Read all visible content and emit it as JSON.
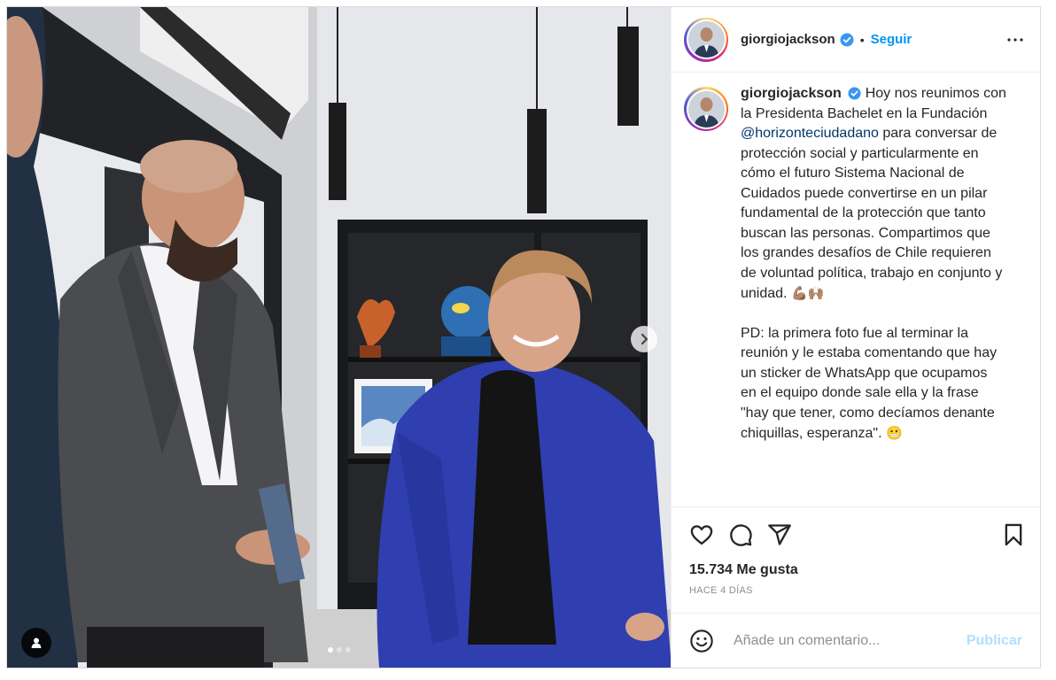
{
  "post": {
    "username": "giorgiojackson",
    "follow_label": "Seguir",
    "separator": "•",
    "caption": {
      "part1": "Hoy nos reunimos con la Presidenta Bachelet en la Fundación ",
      "mention": "@horizonteciudadano",
      "part2": " para conversar de protección social y particularmente en cómo el futuro Sistema Nacional de Cuidados puede convertirse en un pilar fundamental de la protección que tanto buscan las personas. Compartimos que los grandes desafíos de Chile requieren de voluntad política, trabajo en conjunto y unidad. ",
      "emoji1": "💪🏽🙌🏽",
      "part3": "PD: la primera foto fue al terminar la reunión y le estaba comentando que hay un sticker de WhatsApp que ocupamos en el equipo donde sale ella y la frase \"hay que tener, como decíamos denante chiquillas, esperanza\". ",
      "emoji2": "😬"
    },
    "likes": "15.734 Me gusta",
    "date": "HACE 4 DÍAS",
    "comment_placeholder": "Añade un comentario...",
    "publish_label": "Publicar",
    "carousel": {
      "current": 1,
      "total": 3
    },
    "colors": {
      "accent": "#0095f6",
      "publish_disabled": "#b2dffc",
      "mention": "#00376b"
    },
    "icons": [
      "more-options-icon",
      "verified-badge-icon",
      "heart-icon",
      "comment-icon",
      "share-icon",
      "bookmark-icon",
      "emoji-icon",
      "next-arrow-icon",
      "user-tag-icon"
    ]
  }
}
